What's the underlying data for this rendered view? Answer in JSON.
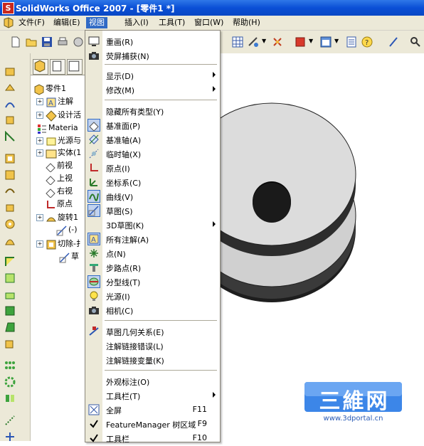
{
  "window": {
    "title": "SolidWorks Office 2007 - [零件1 *]",
    "logo_letter": "S"
  },
  "menubar": {
    "items": [
      {
        "label": "文件(F)",
        "active": false
      },
      {
        "label": "编辑(E)",
        "active": false
      },
      {
        "label": "视图",
        "active": true
      },
      {
        "label": "插入(I)",
        "active": false
      },
      {
        "label": "工具(T)",
        "active": false
      },
      {
        "label": "窗口(W)",
        "active": false
      },
      {
        "label": "帮助(H)",
        "active": false
      }
    ]
  },
  "tree": {
    "rows": [
      {
        "label": "零件1",
        "icon": "part-icon"
      },
      {
        "label": "注解",
        "icon": "annotation-icon"
      },
      {
        "label": "设计活",
        "icon": "design-binder-icon"
      },
      {
        "label": "Materia",
        "icon": "material-icon"
      },
      {
        "label": "光源与",
        "icon": "lights-icon"
      },
      {
        "label": "实体(1",
        "icon": "solid-body-icon"
      },
      {
        "label": "前视",
        "icon": "plane-icon"
      },
      {
        "label": "上视",
        "icon": "plane-icon"
      },
      {
        "label": "右视",
        "icon": "plane-icon"
      },
      {
        "label": "原点",
        "icon": "origin-icon"
      },
      {
        "label": "旋转1",
        "icon": "revolve-icon"
      },
      {
        "label": "(-)",
        "icon": "sketch-icon"
      },
      {
        "label": "切除-扌",
        "icon": "cut-icon"
      },
      {
        "label": "草",
        "icon": "sketch-icon"
      }
    ]
  },
  "view_menu": {
    "groups": [
      [
        {
          "label": "重画(R)",
          "icon": "redraw-icon"
        },
        {
          "label": "荧屏捕获(N)",
          "icon": "camera-icon"
        }
      ],
      [
        {
          "label": "显示(D)",
          "submenu": true
        },
        {
          "label": "修改(M)",
          "submenu": true
        }
      ],
      [
        {
          "label": "隐藏所有类型(Y)"
        },
        {
          "label": "基准面(P)",
          "icon": "plane-icon",
          "checked": true
        },
        {
          "label": "基准轴(A)",
          "icon": "axis-icon"
        },
        {
          "label": "临时轴(X)",
          "icon": "temp-axis-icon"
        },
        {
          "label": "原点(I)",
          "icon": "origin-icon"
        },
        {
          "label": "坐标系(C)",
          "icon": "coordinate-system-icon"
        },
        {
          "label": "曲线(V)",
          "icon": "curve-icon",
          "checked": true
        },
        {
          "label": "草图(S)",
          "icon": "sketch-icon",
          "checked": true
        },
        {
          "label": "3D草图(K)",
          "submenu": true
        },
        {
          "label": "所有注解(A)",
          "icon": "annotation-icon",
          "checked": true
        },
        {
          "label": "点(N)",
          "icon": "point-icon"
        },
        {
          "label": "步路点(R)",
          "icon": "route-point-icon"
        },
        {
          "label": "分型线(T)",
          "icon": "parting-line-icon",
          "checked": true
        },
        {
          "label": "光源(I)",
          "icon": "light-icon"
        },
        {
          "label": "相机(C)",
          "icon": "camera-icon"
        }
      ],
      [
        {
          "label": "草图几何关系(E)",
          "icon": "sketch-relations-icon"
        },
        {
          "label": "注解链接错误(L)"
        },
        {
          "label": "注解链接变量(K)"
        }
      ],
      [
        {
          "label": "外观标注(O)"
        },
        {
          "label": "工具栏(T)",
          "submenu": true
        },
        {
          "label": "全屏",
          "icon": "fullscreen-icon",
          "shortcut": "F11"
        },
        {
          "label": "FeatureManager 树区域",
          "icon": "check-icon",
          "shortcut": "F9"
        },
        {
          "label": "工具栏",
          "icon": "check-icon",
          "shortcut": "F10"
        }
      ]
    ]
  },
  "watermark": {
    "brand_text": "三維网",
    "url": "www.3dportal.cn"
  },
  "colors": {
    "titlebar": "#0a4fd6",
    "menu_highlight": "#316ac5",
    "menu_bg": "#ece9d8",
    "part": "#d8d8d8"
  }
}
